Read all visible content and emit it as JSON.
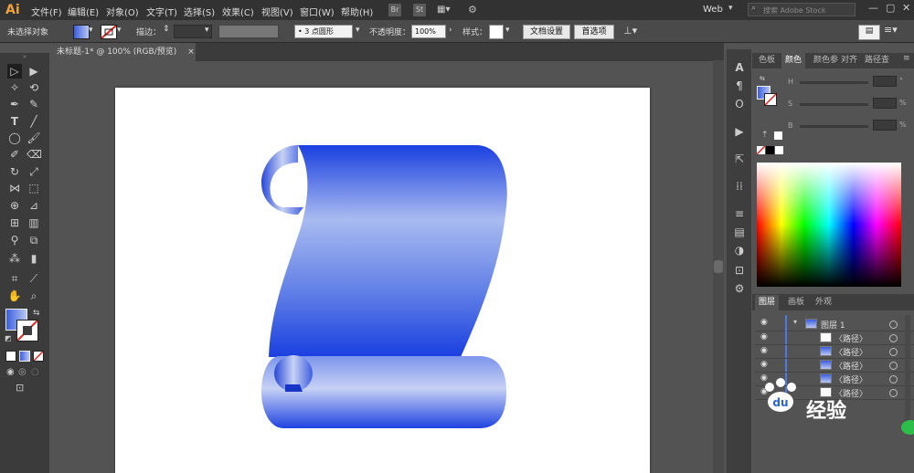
{
  "app": {
    "logo": "Ai"
  },
  "menu": [
    "文件(F)",
    "编辑(E)",
    "对象(O)",
    "文字(T)",
    "选择(S)",
    "效果(C)",
    "视图(V)",
    "窗口(W)",
    "帮助(H)"
  ],
  "bridge": {
    "br": "Br",
    "st": "St"
  },
  "workspace": "Web",
  "search": {
    "placeholder": "搜索 Adobe Stock"
  },
  "control": {
    "selection": "未选择对象",
    "stroke_label": "描边：",
    "brush_value": "3 点圆形",
    "opacity_label": "不透明度：",
    "opacity_value": "100%",
    "style_label": "样式：",
    "doc_setup": "文档设置",
    "prefs": "首选项"
  },
  "document": {
    "tab": "未标题-1* @ 100% (RGB/预览)",
    "close": "×"
  },
  "color_panel": {
    "tabs": [
      "色板",
      "颜色",
      "颜色参",
      "对齐",
      "路径查"
    ],
    "active_tab": "颜色",
    "channels": [
      {
        "label": "H",
        "unit": "°"
      },
      {
        "label": "S",
        "unit": "%"
      },
      {
        "label": "B",
        "unit": "%"
      }
    ]
  },
  "layers_panel": {
    "tabs": [
      "图层",
      "画板",
      "外观"
    ],
    "layer_name": "图层 1",
    "paths": [
      "〈路径〉",
      "〈路径〉",
      "〈路径〉",
      "〈路径〉",
      "〈路径〉"
    ]
  },
  "watermark": "经验",
  "colors": {
    "scroll_blue_dark": "#1437d8",
    "scroll_blue_light": "#a8b8ee",
    "accent": "#f0a33a"
  }
}
